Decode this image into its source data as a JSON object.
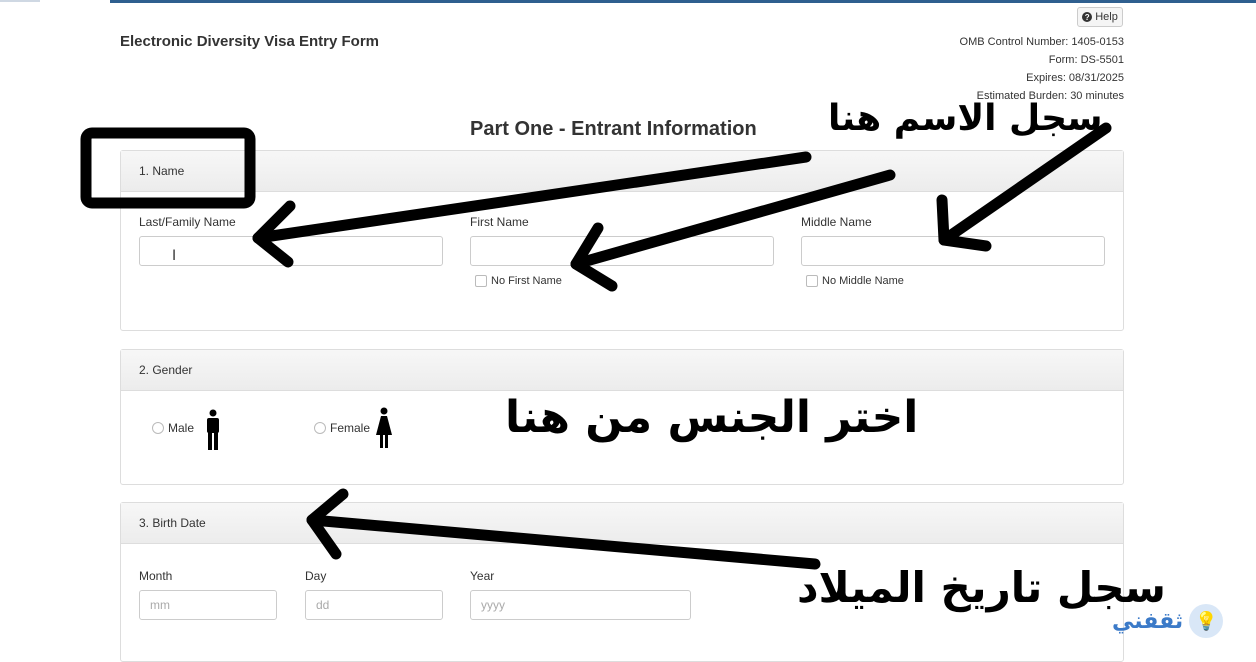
{
  "header": {
    "title": "Electronic Diversity Visa Entry Form",
    "help_label": "Help",
    "omb": "OMB Control Number: 1405-0153",
    "form": "Form: DS-5501",
    "expires": "Expires: 08/31/2025",
    "burden": "Estimated Burden: 30 minutes"
  },
  "part_title": "Part One - Entrant Information",
  "name_section": {
    "heading": "1. Name",
    "last_label": "Last/Family Name",
    "first_label": "First Name",
    "middle_label": "Middle Name",
    "no_first": "No First Name",
    "no_middle": "No Middle Name"
  },
  "gender_section": {
    "heading": "2. Gender",
    "male": "Male",
    "female": "Female"
  },
  "birth_section": {
    "heading": "3. Birth Date",
    "month_label": "Month",
    "day_label": "Day",
    "year_label": "Year",
    "month_placeholder": "mm",
    "day_placeholder": "dd",
    "year_placeholder": "yyyy"
  },
  "annotations": {
    "name_note": "سجل الاسم هنا",
    "gender_note": "اختر الجنس من هنا",
    "birth_note": "سجل تاريخ الميلاد",
    "annotation_color": "#000000"
  },
  "watermark": {
    "text": "ثقفني",
    "icon": "lightbulb-icon",
    "color": "#3b7ac8"
  },
  "icons": {
    "male": "male-figure-icon",
    "female": "female-figure-icon",
    "help": "question-circle-icon",
    "cursor": "text-cursor-icon"
  }
}
